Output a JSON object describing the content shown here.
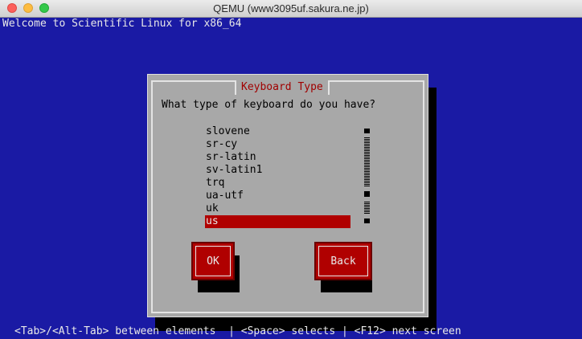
{
  "window": {
    "title": "QEMU (www3095uf.sakura.ne.jp)"
  },
  "screen": {
    "welcome": "Welcome to Scientific Linux for x86_64",
    "hint": "<Tab>/<Alt-Tab> between elements  | <Space> selects | <F12> next screen"
  },
  "dialog": {
    "title": "Keyboard Type",
    "question": "What type of keyboard do you have?",
    "items": [
      "slovene",
      "sr-cy",
      "sr-latin",
      "sv-latin1",
      "trq",
      "ua-utf",
      "uk",
      "us"
    ],
    "selected": "us",
    "ok_label": "OK",
    "back_label": "Back"
  },
  "colors": {
    "screen_bg": "#1a1aa4",
    "dialog_bg": "#a8a8a8",
    "selection": "#b00000",
    "title_text": "#a00000"
  }
}
